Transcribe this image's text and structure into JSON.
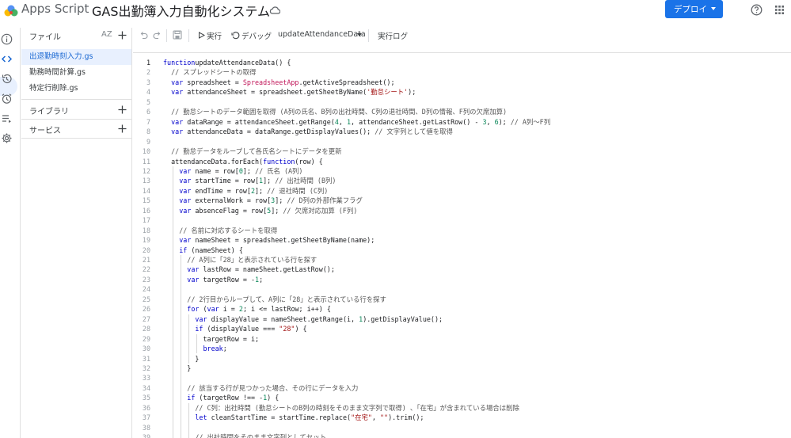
{
  "header": {
    "app_name": "Apps Script",
    "project_title": "GAS出勤簿入力自動化システム",
    "deploy_label": "デプロイ"
  },
  "sidebar": {
    "files_heading": "ファイル",
    "sort_label": "AZ",
    "files": [
      {
        "name": "出退勤時刻入力.gs",
        "active": true
      },
      {
        "name": "勤務時間計算.gs",
        "active": false
      },
      {
        "name": "特定行削除.gs",
        "active": false
      }
    ],
    "libraries_heading": "ライブラリ",
    "services_heading": "サービス"
  },
  "toolbar": {
    "run_label": "実行",
    "debug_label": "デバッグ",
    "function_name": "updateAttendanceData",
    "log_label": "実行ログ"
  },
  "editor": {
    "current_line": 1,
    "lines": [
      {
        "n": "1",
        "indent": 0,
        "tokens": [
          [
            "kw",
            "function"
          ],
          [
            "",
            "updateAttendanceData() {"
          ]
        ]
      },
      {
        "n": "2",
        "indent": 1,
        "tokens": [
          [
            "cm",
            "// スプレッドシートの取得"
          ]
        ]
      },
      {
        "n": "3",
        "indent": 1,
        "tokens": [
          [
            "kw",
            "var"
          ],
          [
            "",
            " spreadsheet = "
          ],
          [
            "cls",
            "SpreadsheetApp"
          ],
          [
            "",
            ".getActiveSpreadsheet();"
          ]
        ]
      },
      {
        "n": "4",
        "indent": 1,
        "tokens": [
          [
            "kw",
            "var"
          ],
          [
            "",
            " attendanceSheet = spreadsheet.getSheetByName("
          ],
          [
            "str",
            "'勤怠シート'"
          ],
          [
            "",
            ");"
          ]
        ]
      },
      {
        "n": "5",
        "indent": 0,
        "tokens": []
      },
      {
        "n": "6",
        "indent": 1,
        "tokens": [
          [
            "cm",
            "// 勤怠シートのデータ範囲を取得 (A列の氏名、B列の出社時間、C列の退社時間、D列の情報、F列の欠席加算)"
          ]
        ]
      },
      {
        "n": "7",
        "indent": 1,
        "tokens": [
          [
            "kw",
            "var"
          ],
          [
            "",
            " dataRange = attendanceSheet.getRange("
          ],
          [
            "num",
            "4"
          ],
          [
            "",
            ", "
          ],
          [
            "num",
            "1"
          ],
          [
            "",
            ", attendanceSheet.getLastRow() - "
          ],
          [
            "num",
            "3"
          ],
          [
            "",
            ", "
          ],
          [
            "num",
            "6"
          ],
          [
            "",
            "); "
          ],
          [
            "cm",
            "// A列〜F列"
          ]
        ]
      },
      {
        "n": "8",
        "indent": 1,
        "tokens": [
          [
            "kw",
            "var"
          ],
          [
            "",
            " attendanceData = dataRange.getDisplayValues(); "
          ],
          [
            "cm",
            "// 文字列として値を取得"
          ]
        ]
      },
      {
        "n": "9",
        "indent": 0,
        "tokens": []
      },
      {
        "n": "10",
        "indent": 1,
        "tokens": [
          [
            "cm",
            "// 勤怠データをループして各氏名シートにデータを更新"
          ]
        ]
      },
      {
        "n": "11",
        "indent": 1,
        "tokens": [
          [
            "",
            "attendanceData.forEach("
          ],
          [
            "kw",
            "function"
          ],
          [
            "",
            "(row) {"
          ]
        ]
      },
      {
        "n": "12",
        "indent": 2,
        "tokens": [
          [
            "kw",
            "var"
          ],
          [
            "",
            " name = row["
          ],
          [
            "num",
            "0"
          ],
          [
            "",
            "]; "
          ],
          [
            "cm",
            "// 氏名 (A列)"
          ]
        ]
      },
      {
        "n": "13",
        "indent": 2,
        "tokens": [
          [
            "kw",
            "var"
          ],
          [
            "",
            " startTime = row["
          ],
          [
            "num",
            "1"
          ],
          [
            "",
            "]; "
          ],
          [
            "cm",
            "// 出社時間 (B列)"
          ]
        ]
      },
      {
        "n": "14",
        "indent": 2,
        "tokens": [
          [
            "kw",
            "var"
          ],
          [
            "",
            " endTime = row["
          ],
          [
            "num",
            "2"
          ],
          [
            "",
            "]; "
          ],
          [
            "cm",
            "// 退社時間 (C列)"
          ]
        ]
      },
      {
        "n": "15",
        "indent": 2,
        "tokens": [
          [
            "kw",
            "var"
          ],
          [
            "",
            " externalWork = row["
          ],
          [
            "num",
            "3"
          ],
          [
            "",
            "]; "
          ],
          [
            "cm",
            "// D列の外部作業フラグ"
          ]
        ]
      },
      {
        "n": "16",
        "indent": 2,
        "tokens": [
          [
            "kw",
            "var"
          ],
          [
            "",
            " absenceFlag = row["
          ],
          [
            "num",
            "5"
          ],
          [
            "",
            "]; "
          ],
          [
            "cm",
            "// 欠席対応加算 (F列)"
          ]
        ]
      },
      {
        "n": "17",
        "indent": 0,
        "tokens": []
      },
      {
        "n": "18",
        "indent": 2,
        "tokens": [
          [
            "cm",
            "// 名前に対応するシートを取得"
          ]
        ]
      },
      {
        "n": "19",
        "indent": 2,
        "tokens": [
          [
            "kw",
            "var"
          ],
          [
            "",
            " nameSheet = spreadsheet.getSheetByName(name);"
          ]
        ]
      },
      {
        "n": "20",
        "indent": 2,
        "tokens": [
          [
            "kw",
            "if"
          ],
          [
            "",
            " (nameSheet) {"
          ]
        ]
      },
      {
        "n": "21",
        "indent": 3,
        "tokens": [
          [
            "cm",
            "// A列に「28」と表示されている行を探す"
          ]
        ]
      },
      {
        "n": "22",
        "indent": 3,
        "tokens": [
          [
            "kw",
            "var"
          ],
          [
            "",
            " lastRow = nameSheet.getLastRow();"
          ]
        ]
      },
      {
        "n": "23",
        "indent": 3,
        "tokens": [
          [
            "kw",
            "var"
          ],
          [
            "",
            " targetRow = -"
          ],
          [
            "num",
            "1"
          ],
          [
            "",
            ";"
          ]
        ]
      },
      {
        "n": "24",
        "indent": 0,
        "tokens": []
      },
      {
        "n": "25",
        "indent": 3,
        "tokens": [
          [
            "cm",
            "// 2行目からループして、A列に「28」と表示されている行を探す"
          ]
        ]
      },
      {
        "n": "26",
        "indent": 3,
        "tokens": [
          [
            "kw",
            "for"
          ],
          [
            "",
            " ("
          ],
          [
            "kw",
            "var"
          ],
          [
            "",
            " i = "
          ],
          [
            "num",
            "2"
          ],
          [
            "",
            "; i <= lastRow; i++) {"
          ]
        ]
      },
      {
        "n": "27",
        "indent": 4,
        "tokens": [
          [
            "kw",
            "var"
          ],
          [
            "",
            " displayValue = nameSheet.getRange(i, "
          ],
          [
            "num",
            "1"
          ],
          [
            "",
            ").getDisplayValue();"
          ]
        ]
      },
      {
        "n": "28",
        "indent": 4,
        "tokens": [
          [
            "kw",
            "if"
          ],
          [
            "",
            " (displayValue === "
          ],
          [
            "str",
            "\"28\""
          ],
          [
            "",
            ") {"
          ]
        ]
      },
      {
        "n": "29",
        "indent": 5,
        "tokens": [
          [
            "",
            "targetRow = i;"
          ]
        ]
      },
      {
        "n": "30",
        "indent": 5,
        "tokens": [
          [
            "kw",
            "break"
          ],
          [
            "",
            ";"
          ]
        ]
      },
      {
        "n": "31",
        "indent": 4,
        "tokens": [
          [
            "",
            "}"
          ]
        ]
      },
      {
        "n": "32",
        "indent": 3,
        "tokens": [
          [
            "",
            "}"
          ]
        ]
      },
      {
        "n": "33",
        "indent": 0,
        "tokens": []
      },
      {
        "n": "34",
        "indent": 3,
        "tokens": [
          [
            "cm",
            "// 該当する行が見つかった場合、その行にデータを入力"
          ]
        ]
      },
      {
        "n": "35",
        "indent": 3,
        "tokens": [
          [
            "kw",
            "if"
          ],
          [
            "",
            " (targetRow !== -"
          ],
          [
            "num",
            "1"
          ],
          [
            "",
            ") {"
          ]
        ]
      },
      {
        "n": "36",
        "indent": 4,
        "tokens": [
          [
            "cm",
            "// C列：出社時間 (勤怠シートのB列の時刻をそのまま文字列で取得) 、「在宅」が含まれている場合は削除"
          ]
        ]
      },
      {
        "n": "37",
        "indent": 4,
        "tokens": [
          [
            "kw",
            "let"
          ],
          [
            "",
            " cleanStartTime = startTime.replace("
          ],
          [
            "str",
            "\"在宅\""
          ],
          [
            "",
            ", "
          ],
          [
            "str",
            "\"\""
          ],
          [
            "",
            ").trim();"
          ]
        ]
      },
      {
        "n": "38",
        "indent": 0,
        "tokens": []
      },
      {
        "n": "39",
        "indent": 4,
        "tokens": [
          [
            "cm",
            "// 出社時間をそのまま文字列としてセット"
          ]
        ]
      }
    ]
  }
}
